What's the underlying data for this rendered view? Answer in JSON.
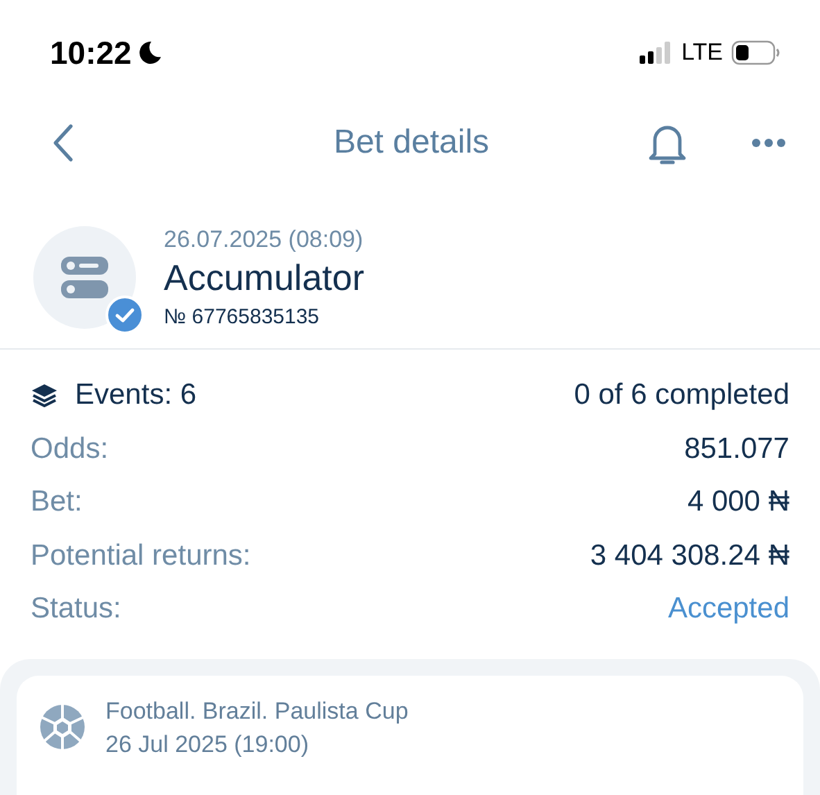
{
  "status_bar": {
    "time": "10:22",
    "network": "LTE"
  },
  "nav": {
    "title": "Bet details"
  },
  "bet": {
    "date": "26.07.2025 (08:09)",
    "type": "Accumulator",
    "number": "№ 67765835135",
    "verified": true
  },
  "summary": [
    {
      "kind": "events",
      "label": "Events: 6",
      "value": "0 of 6 completed"
    },
    {
      "kind": "plain",
      "label": "Odds:",
      "value": "851.077"
    },
    {
      "kind": "plain",
      "label": "Bet:",
      "value": "4 000 ₦"
    },
    {
      "kind": "plain",
      "label": "Potential returns:",
      "value": "3 404 308.24 ₦"
    },
    {
      "kind": "status",
      "label": "Status:",
      "value": "Accepted"
    }
  ],
  "events": [
    {
      "tournament": "Football. Brazil. Paulista Cup",
      "date": "26 Jul 2025 (19:00)"
    }
  ]
}
